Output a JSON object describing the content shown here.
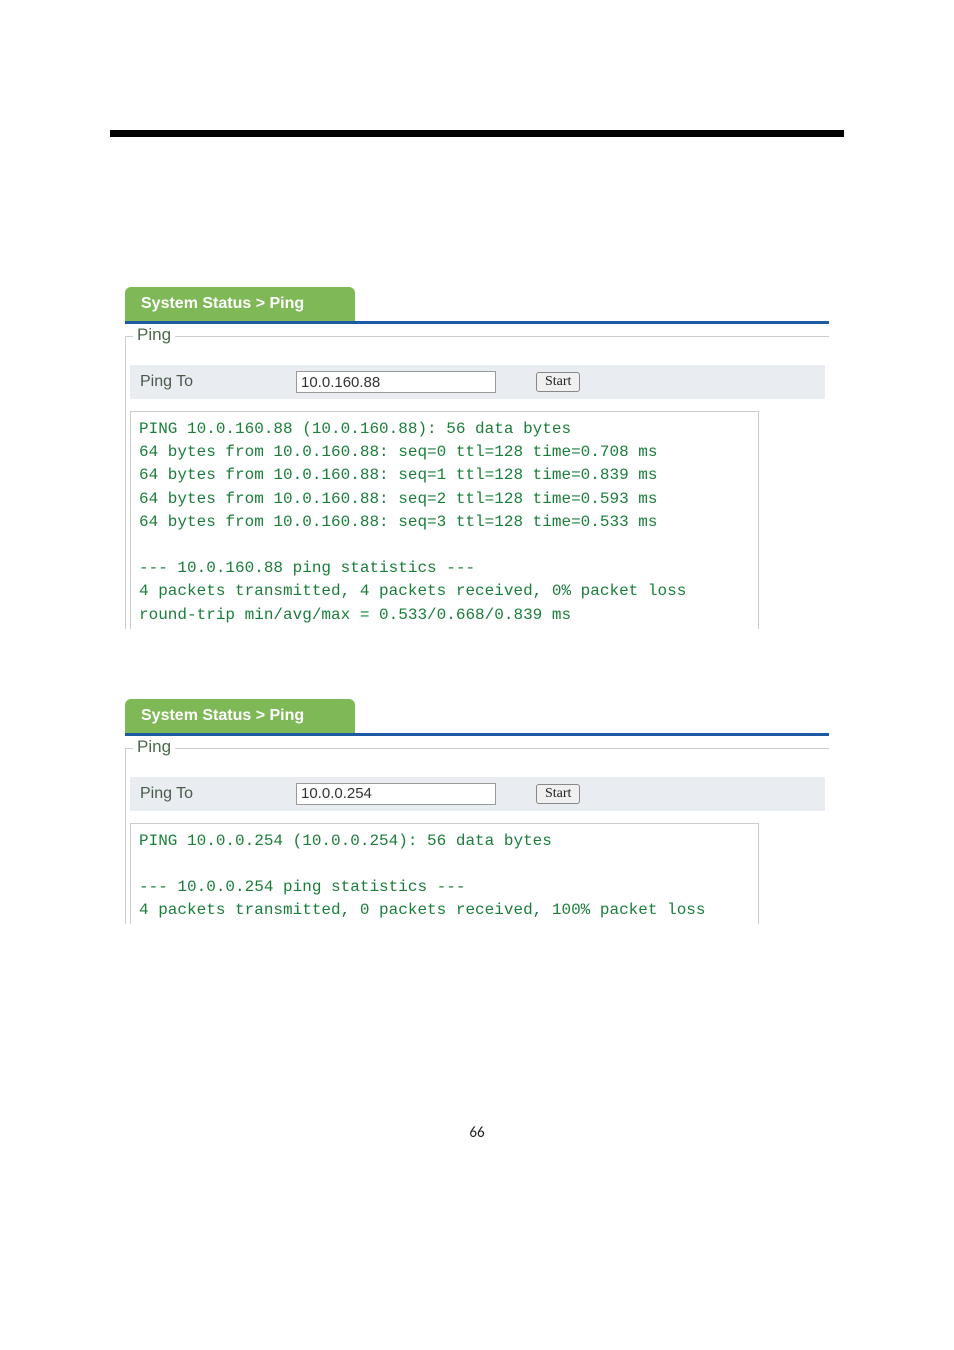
{
  "page_number": "66",
  "panels": [
    {
      "breadcrumb": "System Status > Ping",
      "fieldset_title": "Ping",
      "ping_to_label": "Ping To",
      "ping_to_value": "10.0.160.88",
      "start_label": "Start",
      "output": "PING 10.0.160.88 (10.0.160.88): 56 data bytes\n64 bytes from 10.0.160.88: seq=0 ttl=128 time=0.708 ms\n64 bytes from 10.0.160.88: seq=1 ttl=128 time=0.839 ms\n64 bytes from 10.0.160.88: seq=2 ttl=128 time=0.593 ms\n64 bytes from 10.0.160.88: seq=3 ttl=128 time=0.533 ms\n\n--- 10.0.160.88 ping statistics ---\n4 packets transmitted, 4 packets received, 0% packet loss\nround-trip min/avg/max = 0.533/0.668/0.839 ms"
    },
    {
      "breadcrumb": "System Status > Ping",
      "fieldset_title": "Ping",
      "ping_to_label": "Ping To",
      "ping_to_value": "10.0.0.254",
      "start_label": "Start",
      "output": "PING 10.0.0.254 (10.0.0.254): 56 data bytes\n\n--- 10.0.0.254 ping statistics ---\n4 packets transmitted, 0 packets received, 100% packet loss"
    }
  ]
}
